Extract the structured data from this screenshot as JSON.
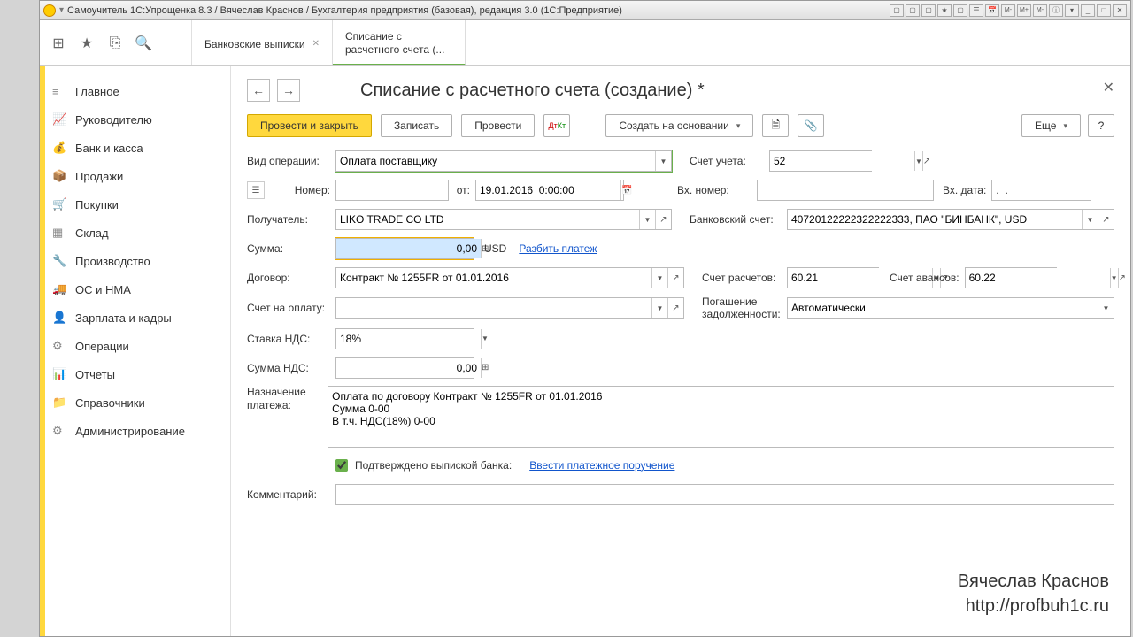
{
  "window": {
    "title": "Самоучитель 1С:Упрощенка 8.3 / Вячеслав Краснов / Бухгалтерия предприятия (базовая), редакция 3.0  (1С:Предприятие)",
    "toolbar_icons": [
      "📄",
      "📊",
      "📃",
      "★",
      "📋",
      "☰",
      "📊",
      "M-",
      "M+",
      "M-",
      "ⓘ",
      "▾",
      "_",
      "□",
      "✕"
    ]
  },
  "tabs": [
    {
      "label": "Банковские выписки",
      "active": false
    },
    {
      "label": "Списание с\nрасчетного счета (...",
      "active": true
    }
  ],
  "sidebar": {
    "items": [
      {
        "icon": "≡",
        "label": "Главное"
      },
      {
        "icon": "📈",
        "label": "Руководителю"
      },
      {
        "icon": "💰",
        "label": "Банк и касса"
      },
      {
        "icon": "📦",
        "label": "Продажи"
      },
      {
        "icon": "🛒",
        "label": "Покупки"
      },
      {
        "icon": "▦",
        "label": "Склад"
      },
      {
        "icon": "🔧",
        "label": "Производство"
      },
      {
        "icon": "🚚",
        "label": "ОС и НМА"
      },
      {
        "icon": "👤",
        "label": "Зарплата и кадры"
      },
      {
        "icon": "⚙",
        "label": "Операции"
      },
      {
        "icon": "📊",
        "label": "Отчеты"
      },
      {
        "icon": "📁",
        "label": "Справочники"
      },
      {
        "icon": "⚙",
        "label": "Администрирование"
      }
    ]
  },
  "page": {
    "title": "Списание с расчетного счета (создание) *",
    "buttons": {
      "post_close": "Провести и закрыть",
      "save": "Записать",
      "post": "Провести",
      "create_based": "Создать на основании",
      "more": "Еще",
      "help": "?"
    },
    "form": {
      "op_type_label": "Вид операции:",
      "op_type_value": "Оплата поставщику",
      "account_label": "Счет учета:",
      "account_value": "52",
      "number_label": "Номер:",
      "number_value": "",
      "from_label": "от:",
      "from_value": "19.01.2016  0:00:00",
      "inc_number_label": "Вх. номер:",
      "inc_number_value": "",
      "inc_date_label": "Вх. дата:",
      "inc_date_value": ".  .",
      "payee_label": "Получатель:",
      "payee_value": "LIKO TRADE CO LTD",
      "bank_acc_label": "Банковский счет:",
      "bank_acc_value": "40720122222322222333, ПАО \"БИНБАНК\", USD",
      "sum_label": "Сумма:",
      "sum_value": "0,00",
      "currency": "USD",
      "split_link": "Разбить платеж",
      "contract_label": "Договор:",
      "contract_value": "Контракт № 1255FR от 01.01.2016",
      "settle_acc_label": "Счет расчетов:",
      "settle_acc_value": "60.21",
      "advance_acc_label": "Счет авансов:",
      "advance_acc_value": "60.22",
      "invoice_label": "Счет на оплату:",
      "invoice_value": "",
      "debt_label": "Погашение задолженности:",
      "debt_value": "Автоматически",
      "vat_rate_label": "Ставка НДС:",
      "vat_rate_value": "18%",
      "vat_sum_label": "Сумма НДС:",
      "vat_sum_value": "0,00",
      "purpose_label": "Назначение платежа:",
      "purpose_value": "Оплата по договору Контракт № 1255FR от 01.01.2016\nСумма 0-00\nВ т.ч. НДС(18%) 0-00",
      "confirmed_label": "Подтверждено выпиской банка:",
      "enter_payment_link": "Ввести платежное поручение",
      "comment_label": "Комментарий:",
      "comment_value": ""
    }
  },
  "watermark": {
    "name": "Вячеслав Краснов",
    "url": "http://profbuh1c.ru"
  }
}
